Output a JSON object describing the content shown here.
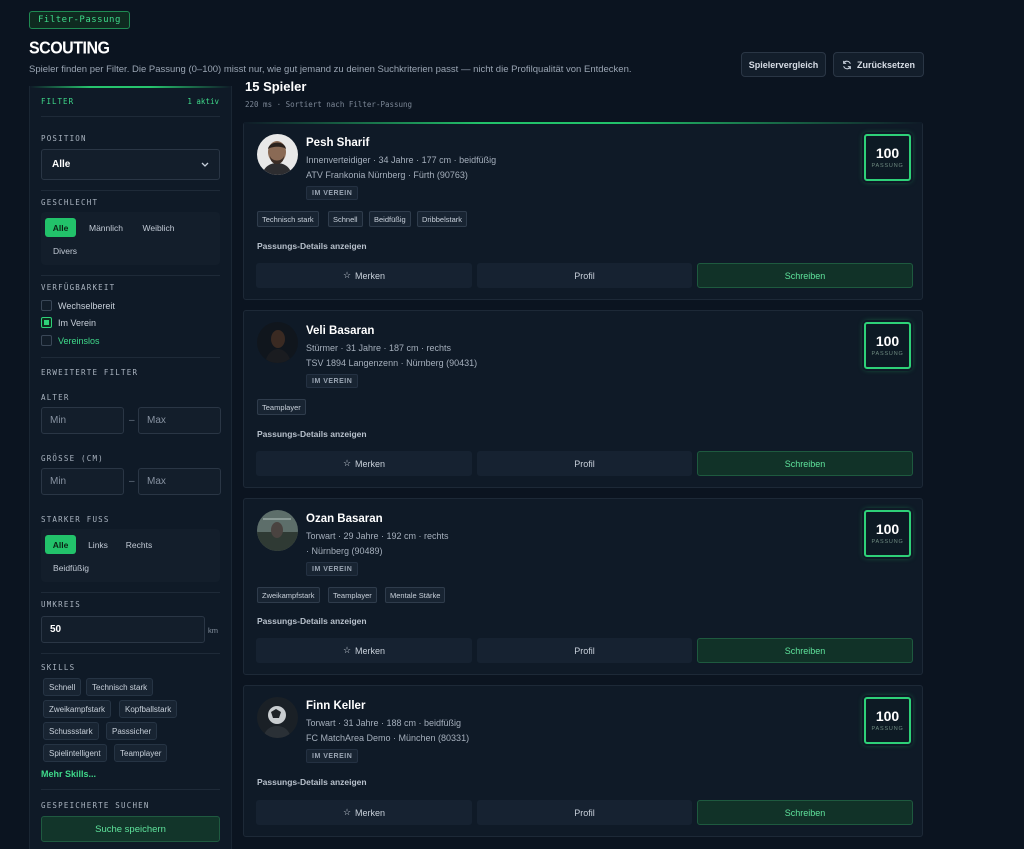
{
  "badge": "Filter-Passung",
  "title": "SCOUTING",
  "subtitle": "Spieler finden per Filter. Die Passung (0–100) misst nur, wie gut jemand zu deinen Suchkriterien passt — nicht die Profilqualität von Entdecken.",
  "toolbar": {
    "compare": "Spielervergleich",
    "reset": "Zurücksetzen"
  },
  "filter": {
    "heading": "FILTER",
    "active": "1 aktiv",
    "position_label": "POSITION",
    "position_value": "Alle",
    "gender_label": "GESCHLECHT",
    "gender_options": [
      "Alle",
      "Männlich",
      "Weiblich",
      "Divers"
    ],
    "gender_selected": "Alle",
    "availability_label": "VERFÜGBARKEIT",
    "availability": [
      {
        "label": "Wechselbereit",
        "checked": false
      },
      {
        "label": "Im Verein",
        "checked": true
      },
      {
        "label": "Vereinslos",
        "checked": false
      }
    ],
    "advanced_label": "ERWEITERTE FILTER",
    "age_label": "ALTER",
    "age_min_placeholder": "Min",
    "age_max_placeholder": "Max",
    "height_label": "GRÖSSE (CM)",
    "height_min_placeholder": "Min",
    "height_max_placeholder": "Max",
    "foot_label": "STARKER FUSS",
    "foot_options": [
      "Alle",
      "Links",
      "Rechts",
      "Beidfüßig"
    ],
    "foot_selected": "Alle",
    "radius_label": "UMKREIS",
    "radius_value": "50",
    "radius_unit": "km",
    "skills_label": "SKILLS",
    "skills": [
      "Schnell",
      "Technisch stark",
      "Zweikampfstark",
      "Kopfballstark",
      "Schussstark",
      "Passsicher",
      "Spielintelligent",
      "Teamplayer"
    ],
    "more_skills": "Mehr Skills...",
    "saved_label": "GESPEICHERTE SUCHEN",
    "save_button": "Suche speichern"
  },
  "results": {
    "count": "15 Spieler",
    "meta": "220 ms · Sortiert nach Filter-Passung",
    "cards": [
      {
        "name": "Pesh Sharif",
        "info1": "Innenverteidiger · 34 Jahre · 177 cm · beidfüßig",
        "info2": "ATV Frankonia Nürnberg · Fürth (90763)",
        "badge": "IM VEREIN",
        "score": "100",
        "score_label": "PASSUNG",
        "tags": [
          "Technisch stark",
          "Schnell",
          "Beidfüßig",
          "Dribbelstark"
        ],
        "details": "Passungs-Details anzeigen",
        "merken": "Merken",
        "profil": "Profil",
        "schreiben": "Schreiben"
      },
      {
        "name": "Veli Basaran",
        "info1": "Stürmer · 31 Jahre · 187 cm · rechts",
        "info2": "TSV 1894 Langenzenn · Nürnberg (90431)",
        "badge": "IM VEREIN",
        "score": "100",
        "score_label": "PASSUNG",
        "tags": [
          "Teamplayer"
        ],
        "details": "Passungs-Details anzeigen",
        "merken": "Merken",
        "profil": "Profil",
        "schreiben": "Schreiben"
      },
      {
        "name": "Ozan Basaran",
        "info1": "Torwart · 29 Jahre · 192 cm · rechts",
        "info2": "· Nürnberg (90489)",
        "badge": "IM VEREIN",
        "score": "100",
        "score_label": "PASSUNG",
        "tags": [
          "Zweikampfstark",
          "Teamplayer",
          "Mentale Stärke"
        ],
        "details": "Passungs-Details anzeigen",
        "merken": "Merken",
        "profil": "Profil",
        "schreiben": "Schreiben"
      },
      {
        "name": "Finn Keller",
        "info1": "Torwart · 31 Jahre · 188 cm · beidfüßig",
        "info2": "FC MatchArea Demo · München (80331)",
        "badge": "IM VEREIN",
        "score": "100",
        "score_label": "PASSUNG",
        "tags": [],
        "details": "Passungs-Details anzeigen",
        "merken": "Merken",
        "profil": "Profil",
        "schreiben": "Schreiben"
      }
    ]
  },
  "colors": {
    "accent": "#22c26a",
    "background": "#0b1420",
    "panel": "#0f1a27"
  }
}
